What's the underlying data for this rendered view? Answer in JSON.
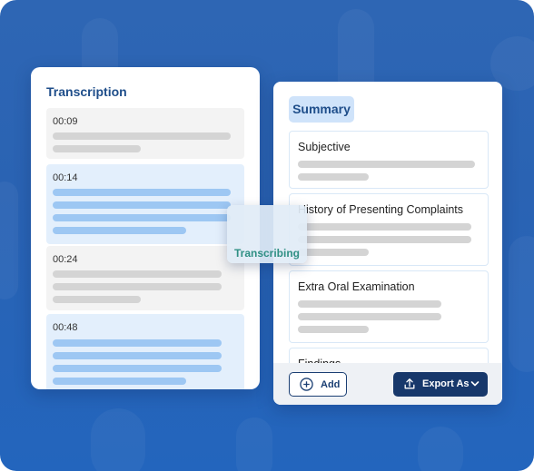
{
  "transcription": {
    "title": "Transcription",
    "entries": [
      {
        "time": "00:09",
        "highlighted": false
      },
      {
        "time": "00:14",
        "highlighted": true
      },
      {
        "time": "00:24",
        "highlighted": false
      },
      {
        "time": "00:48",
        "highlighted": true
      }
    ]
  },
  "summary": {
    "title": "Summary",
    "sections": [
      {
        "title": "Subjective"
      },
      {
        "title": "History of Presenting Complaints"
      },
      {
        "title": "Extra Oral Examination"
      },
      {
        "title": "Findings"
      }
    ],
    "add_label": "Add",
    "export_label": "Export As"
  },
  "badge": {
    "label": "Transcribing",
    "icon": "sound-wave-icon"
  },
  "colors": {
    "background": "#2a63b3",
    "accent": "#17386b",
    "heading": "#1f4e8a",
    "highlight": "#e3effc",
    "transcribing": "#2f8f84"
  }
}
